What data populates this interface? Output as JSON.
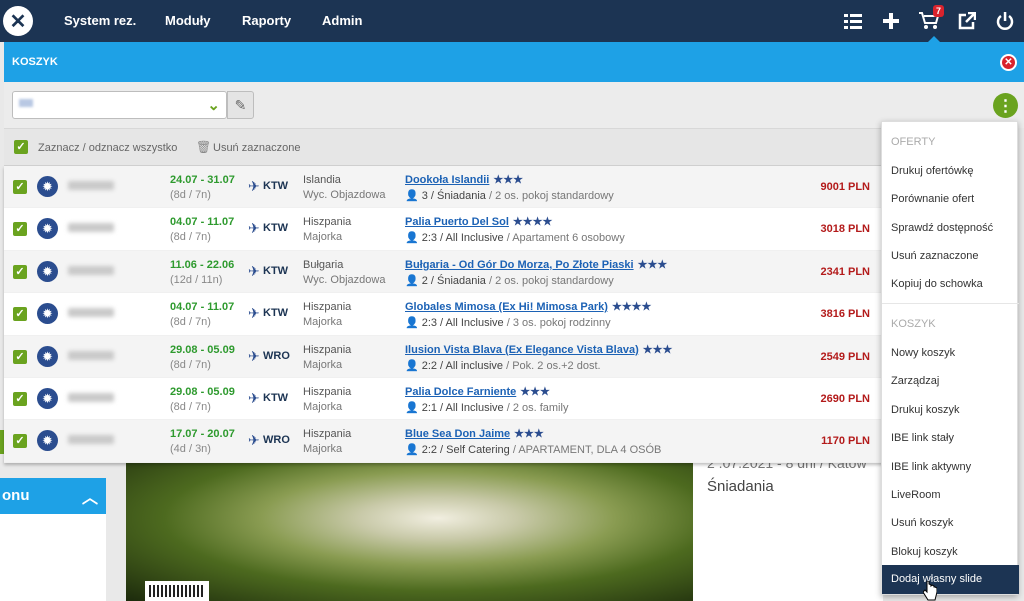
{
  "topbar": {
    "logo_glyph": "✕",
    "nav": [
      "System rez.",
      "Moduły",
      "Raporty",
      "Admin"
    ],
    "icons": [
      "list-icon",
      "plus-icon",
      "cart-icon",
      "external-link-icon",
      "power-icon"
    ],
    "cart_count": "7"
  },
  "cart": {
    "title": "KOSZYK",
    "select_all_label": "Zaznacz / odznacz wszystko",
    "delete_selected_label": "Usuń zaznaczone"
  },
  "offers": [
    {
      "dates": "24.07 - 31.07",
      "nights": "(8d / 7n)",
      "airport": "KTW",
      "country": "Islandia",
      "region": "Wyc. Objazdowa",
      "hotel": "Dookoła Islandii",
      "stars": "★★★",
      "board": "3 / Śniadania",
      "room": "/ 2 os. pokoj standardowy",
      "price": "9001 PLN"
    },
    {
      "dates": "04.07 - 11.07",
      "nights": "(8d / 7n)",
      "airport": "KTW",
      "country": "Hiszpania",
      "region": "Majorka",
      "hotel": "Palia Puerto Del Sol",
      "stars": "★★★★",
      "board": "2:3 / All Inclusive",
      "room": "/ Apartament 6 osobowy",
      "price": "3018 PLN"
    },
    {
      "dates": "11.06 - 22.06",
      "nights": "(12d / 11n)",
      "airport": "KTW",
      "country": "Bułgaria",
      "region": "Wyc. Objazdowa",
      "hotel": "Bułgaria - Od Gór Do Morza, Po Złote Piaski",
      "stars": "★★★",
      "board": "2 / Śniadania",
      "room": "/ 2 os. pokoj standardowy",
      "price": "2341 PLN"
    },
    {
      "dates": "04.07 - 11.07",
      "nights": "(8d / 7n)",
      "airport": "KTW",
      "country": "Hiszpania",
      "region": "Majorka",
      "hotel": "Globales Mimosa (Ex Hi! Mimosa Park)",
      "stars": "★★★★",
      "board": "2:3 / All Inclusive",
      "room": "/ 3 os. pokoj rodzinny",
      "price": "3816 PLN"
    },
    {
      "dates": "29.08 - 05.09",
      "nights": "(8d / 7n)",
      "airport": "WRO",
      "country": "Hiszpania",
      "region": "Majorka",
      "hotel": "Ilusion Vista Blava (Ex Elegance Vista Blava)",
      "stars": "★★★",
      "board": "2:2 / All inclusive",
      "room": "/ Pok. 2 os.+2 dost.",
      "price": "2549 PLN"
    },
    {
      "dates": "29.08 - 05.09",
      "nights": "(8d / 7n)",
      "airport": "KTW",
      "country": "Hiszpania",
      "region": "Majorka",
      "hotel": "Palia Dolce Farniente",
      "stars": "★★★",
      "board": "2:1 / All Inclusive",
      "room": "/ 2 os. family",
      "price": "2690 PLN"
    },
    {
      "dates": "17.07 - 20.07",
      "nights": "(4d / 3n)",
      "airport": "WRO",
      "country": "Hiszpania",
      "region": "Majorka",
      "hotel": "Blue Sea Don Jaime",
      "stars": "★★★",
      "board": "2:2 / Self Catering",
      "room": "/ APARTAMENT, DLA 4 OSÓB",
      "price": "1170 PLN"
    }
  ],
  "menu": {
    "section_offers": "OFERTY",
    "offers_items": [
      "Drukuj ofertówkę",
      "Porównanie ofert",
      "Sprawdź dostępność",
      "Usuń zaznaczone",
      "Kopiuj do schowka"
    ],
    "section_cart": "KOSZYK",
    "cart_items": [
      "Nowy koszyk",
      "Zarządzaj",
      "Drukuj koszyk",
      "IBE link stały",
      "IBE link aktywny",
      "LiveRoom",
      "Usuń koszyk",
      "Blokuj koszyk"
    ],
    "active_item": "Dodaj własny slide"
  },
  "background": {
    "left_panel_label": "onu",
    "detail_date": "2 .07.2021 - 8 dni / Katow",
    "detail_board": "Śniadania"
  }
}
